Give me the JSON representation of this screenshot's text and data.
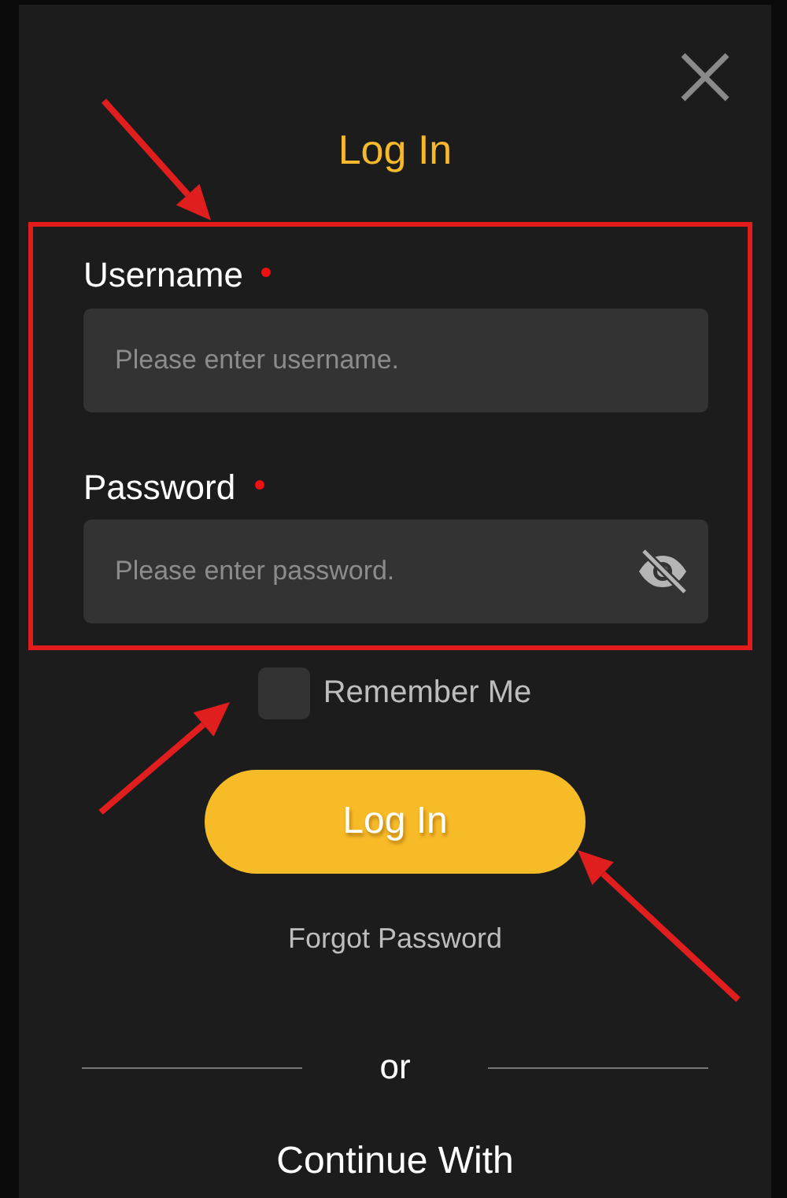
{
  "dialog": {
    "title": "Log In",
    "fields": [
      {
        "kind": "text",
        "label": "Username",
        "required": true,
        "placeholder": "Please enter username."
      },
      {
        "kind": "password",
        "label": "Password",
        "required": true,
        "placeholder": "Please enter password."
      }
    ],
    "remember": {
      "label": "Remember Me",
      "checked": false
    },
    "submit": "Log In",
    "forgot": "Forgot Password",
    "divider": "or",
    "continue": "Continue With"
  }
}
